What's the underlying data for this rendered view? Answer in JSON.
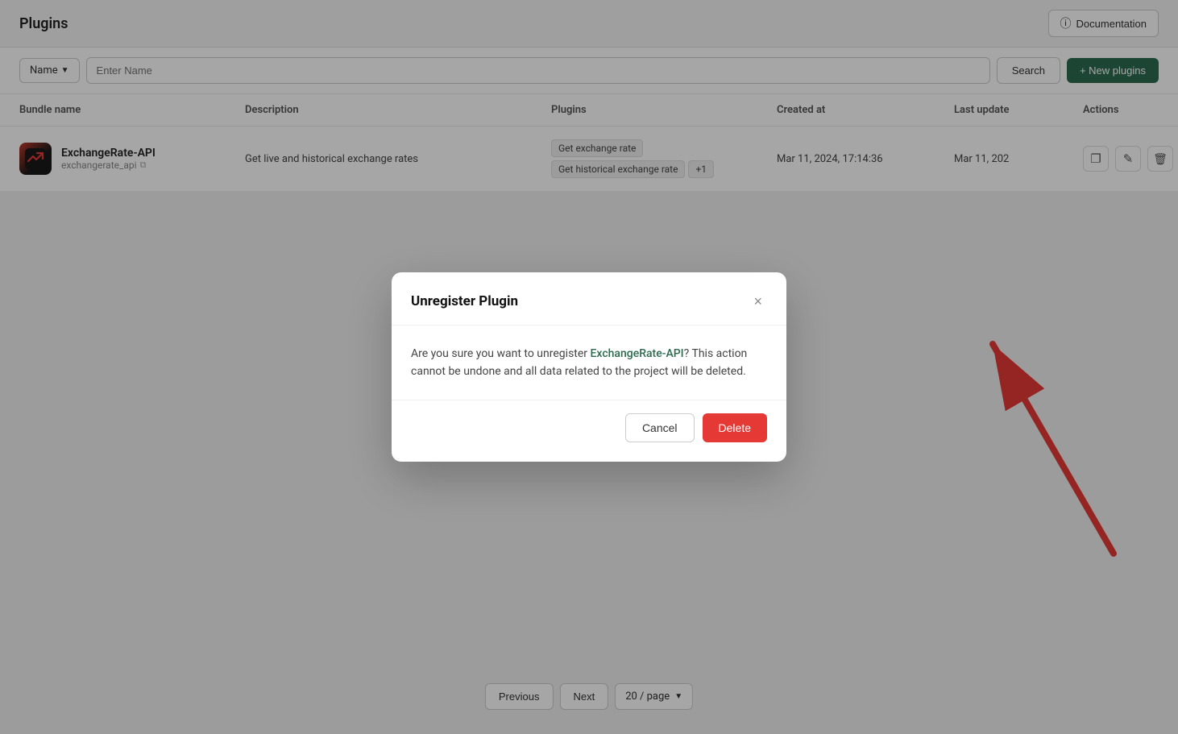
{
  "header": {
    "title": "Plugins",
    "doc_button_label": "Documentation"
  },
  "filter_bar": {
    "dropdown_label": "Name",
    "input_placeholder": "Enter Name",
    "search_label": "Search",
    "new_plugin_label": "+ New plugins"
  },
  "table": {
    "columns": [
      "Bundle name",
      "Description",
      "Plugins",
      "Created at",
      "Last update",
      "Actions"
    ],
    "rows": [
      {
        "bundle_name": "ExchangeRate-API",
        "bundle_key": "exchangerate_api",
        "description": "Get live and historical exchange rates",
        "plugins": [
          "Get exchange rate",
          "Get historical exchange rate"
        ],
        "plugins_extra": "+1",
        "created_at": "Mar 11, 2024, 17:14:36",
        "last_update": "Mar 11, 202"
      }
    ]
  },
  "pagination": {
    "previous_label": "Previous",
    "next_label": "Next",
    "page_size": "20 / page"
  },
  "modal": {
    "title": "Unregister Plugin",
    "close_icon": "×",
    "body_text_prefix": "Are you sure you want to unregister ",
    "plugin_name": "ExchangeRate-API",
    "body_text_suffix": "? This action cannot be undone and all data related to the project will be deleted.",
    "cancel_label": "Cancel",
    "delete_label": "Delete"
  },
  "actions": {
    "configure_icon": "⊞",
    "edit_icon": "✎",
    "delete_icon": "🗑"
  }
}
